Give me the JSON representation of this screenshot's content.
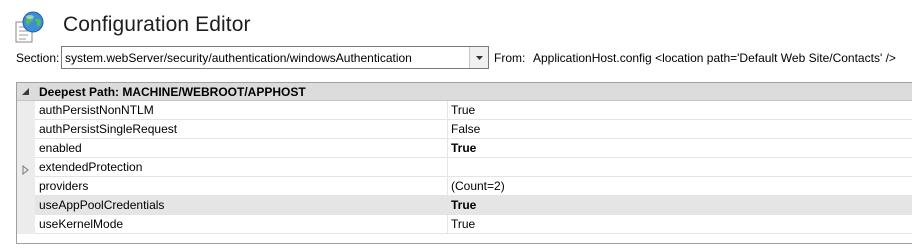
{
  "title": "Configuration Editor",
  "section": {
    "label": "Section:",
    "value": "system.webServer/security/authentication/windowsAuthentication"
  },
  "from": {
    "label": "From:",
    "value": "ApplicationHost.config <location path='Default Web Site/Contacts' />"
  },
  "grid": {
    "group_title": "Deepest Path: MACHINE/WEBROOT/APPHOST",
    "rows": [
      {
        "name": "authPersistNonNTLM",
        "value": "True",
        "bold": false,
        "expandable": false,
        "selected": false
      },
      {
        "name": "authPersistSingleRequest",
        "value": "False",
        "bold": false,
        "expandable": false,
        "selected": false
      },
      {
        "name": "enabled",
        "value": "True",
        "bold": true,
        "expandable": false,
        "selected": false
      },
      {
        "name": "extendedProtection",
        "value": "",
        "bold": false,
        "expandable": true,
        "selected": false
      },
      {
        "name": "providers",
        "value": "(Count=2)",
        "bold": false,
        "expandable": false,
        "selected": false
      },
      {
        "name": "useAppPoolCredentials",
        "value": "True",
        "bold": true,
        "expandable": false,
        "selected": true
      },
      {
        "name": "useKernelMode",
        "value": "True",
        "bold": false,
        "expandable": false,
        "selected": false
      }
    ]
  },
  "icons": {
    "app": "globe-document-icon",
    "combo": "dropdown-arrow-icon",
    "group_toggle": "collapse-triangle-icon",
    "expander": "expand-triangle-icon"
  },
  "colors": {
    "group_header": "#dcdcdc",
    "selected_row": "#e5e5e5",
    "gutter": "#ececec"
  }
}
